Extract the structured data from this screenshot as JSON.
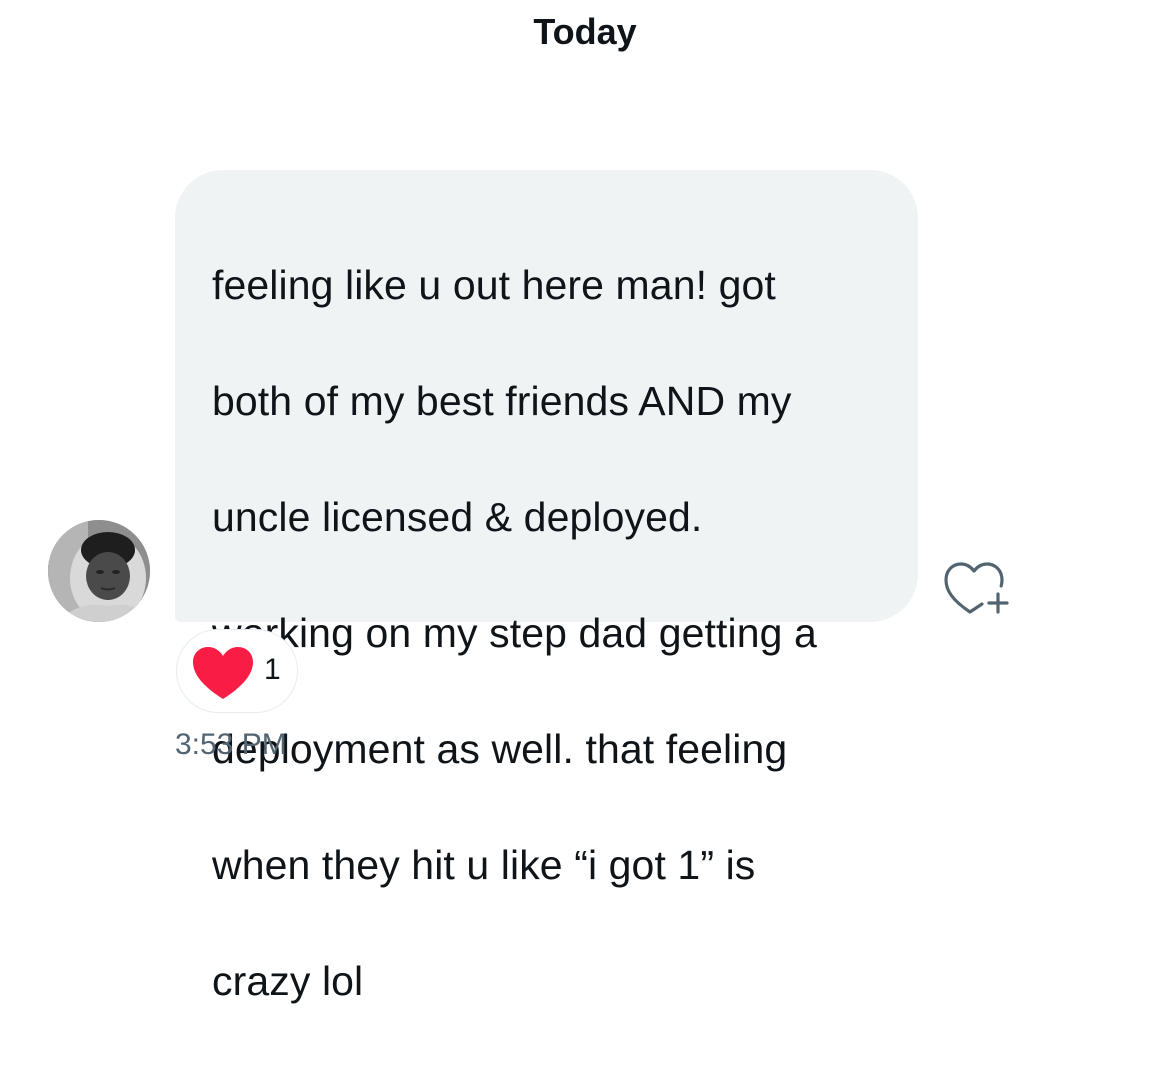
{
  "conversation": {
    "day_label": "Today",
    "message": {
      "lines": [
        "feeling like u out here man! got",
        "both of my best friends AND my",
        "uncle licensed & deployed.",
        "working on my step dad getting a",
        "deployment as well. that feeling",
        "when they hit u like “i got 1” is",
        "crazy lol"
      ],
      "time": "3:53 PM",
      "reaction": {
        "emoji": "heart-icon",
        "count": "1"
      }
    }
  },
  "colors": {
    "bubble_background": "#eff3f4",
    "text_primary": "#0f1419",
    "text_secondary": "#536471",
    "heart_red": "#f91c45",
    "icon_gray": "#536471"
  },
  "icons": {
    "react_button": "heart-plus-icon",
    "avatar": "user-avatar"
  }
}
